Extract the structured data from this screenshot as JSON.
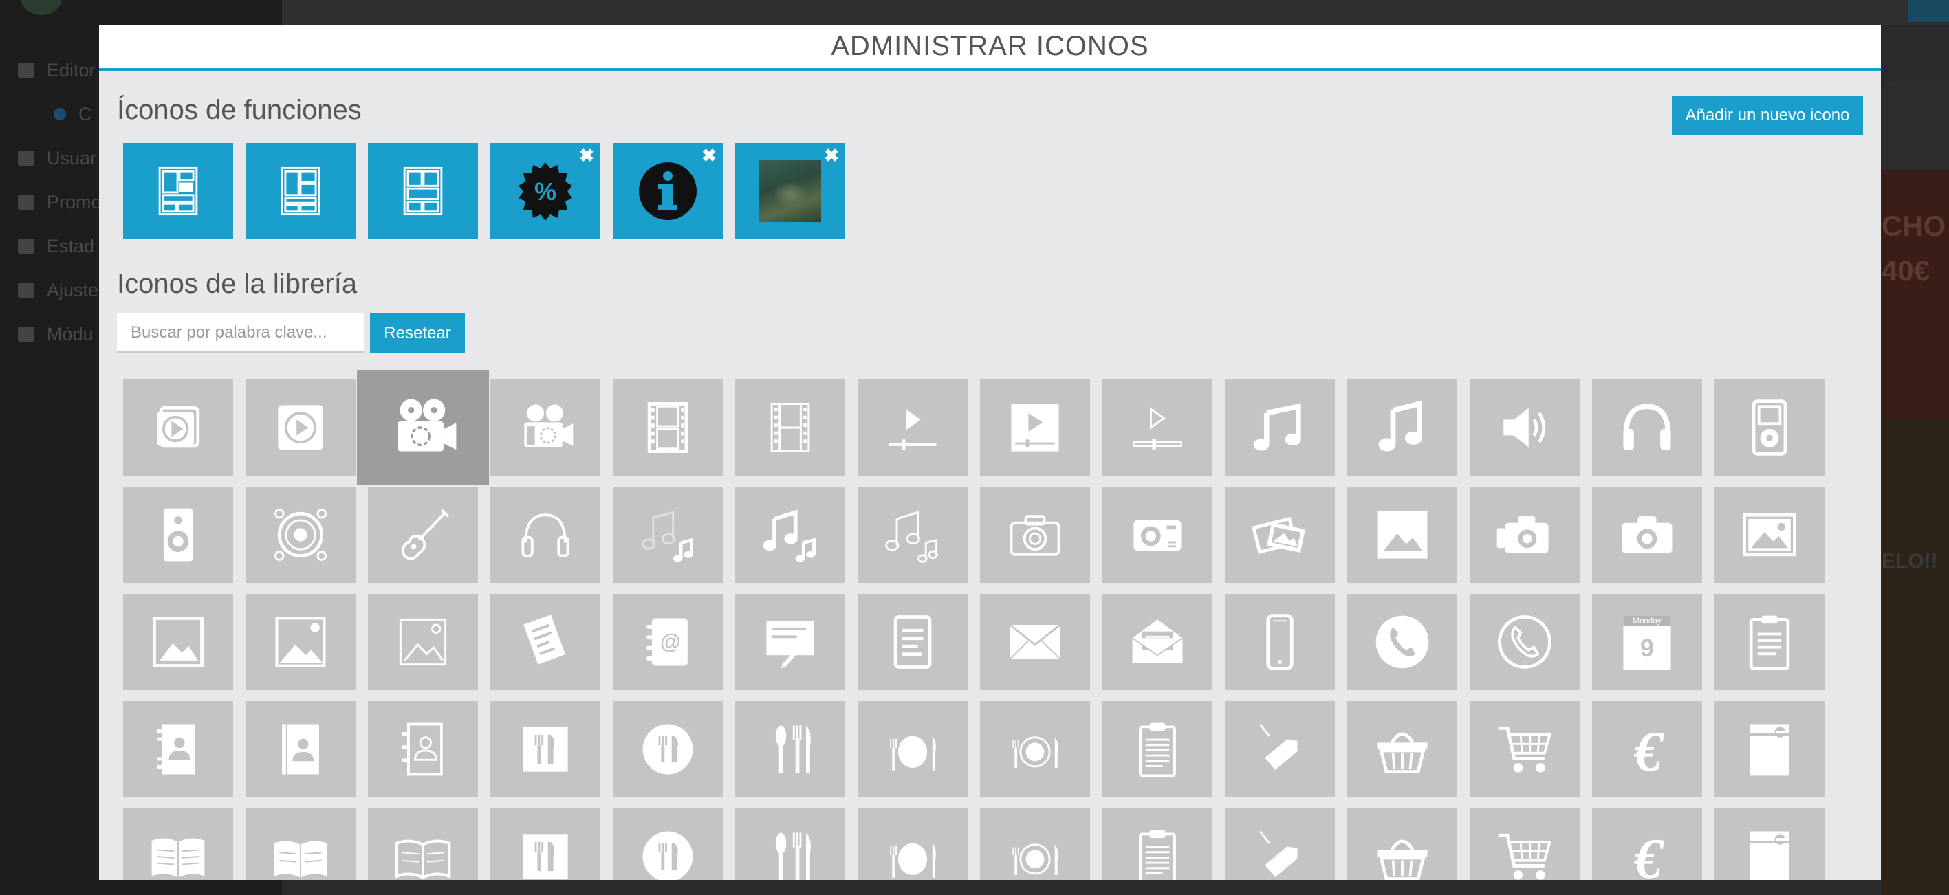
{
  "background": {
    "sidebar_items": [
      {
        "label": "Editor",
        "icon": "pencil-icon"
      },
      {
        "label": "C",
        "icon": "dot-icon",
        "sub": true
      },
      {
        "label": "Usuar",
        "icon": "users-icon"
      },
      {
        "label": "Promo",
        "icon": "megaphone-icon"
      },
      {
        "label": "Estad",
        "icon": "bar-chart-icon"
      },
      {
        "label": "Ajuste",
        "icon": "cogs-icon"
      },
      {
        "label": "Módu",
        "icon": "cubes-icon"
      }
    ],
    "phone_text": [
      "CHO",
      "40€",
      "ELO!!"
    ]
  },
  "modal": {
    "title": "ADMINISTRAR ICONOS",
    "functions_title": "Íconos de funciones",
    "add_button": "Añadir un nuevo icono",
    "library_title": "Iconos de la librería",
    "search_placeholder": "Buscar por palabra clave...",
    "reset_button": "Resetear"
  },
  "function_icons": [
    {
      "icon": "layout-1-icon",
      "removable": false
    },
    {
      "icon": "layout-2-icon",
      "removable": false
    },
    {
      "icon": "layout-3-icon",
      "removable": false
    },
    {
      "icon": "discount-badge-icon",
      "removable": true
    },
    {
      "icon": "info-icon",
      "removable": true
    },
    {
      "icon": "photo-thumbnail",
      "removable": true
    }
  ],
  "library_icons": [
    "video-play-icon",
    "play-circle-icon",
    "film-camera-icon",
    "film-camera-outline-icon",
    "film-strip-icon",
    "film-strip-outline-icon",
    "video-player-icon",
    "video-player-filled-icon",
    "video-player-outline-icon",
    "music-note-icon",
    "music-note-alt-icon",
    "speaker-volume-icon",
    "headphones-icon",
    "ipod-icon",
    "speaker-box-icon",
    "woofer-icon",
    "guitar-icon",
    "headphones-outline-icon",
    "music-notes-outline-icon",
    "music-notes-icon",
    "music-notes-alt-icon",
    "camera-outline-icon",
    "compact-camera-icon",
    "photos-icon",
    "image-icon",
    "camera-icon",
    "camera-alt-icon",
    "picture-icon",
    "image-frame-icon",
    "image-filled-icon",
    "image-outline-icon",
    "receipt-icon",
    "address-book-at-icon",
    "signed-document-icon",
    "document-list-icon",
    "envelope-icon",
    "envelope-open-icon",
    "smartphone-icon",
    "phone-circle-icon",
    "phone-circle-outline-icon",
    "calendar-icon",
    "clipboard-icon",
    "contact-book-icon",
    "contact-book-alt-icon",
    "contact-book-outline-icon",
    "restaurant-menu-icon",
    "plate-circle-icon",
    "fork-knife-icon",
    "dinner-plate-icon",
    "dinner-plate-outline-icon",
    "clipboard-list-icon",
    "price-tag-icon",
    "shopping-basket-icon",
    "shopping-cart-icon",
    "euro-icon",
    "box-icon",
    "open-book-icon",
    "open-book-alt-icon",
    "open-book-outline-icon",
    "restaurant-menu-icon",
    "plate-circle-icon",
    "fork-knife-icon",
    "dinner-plate-icon",
    "dinner-plate-outline-icon",
    "clipboard-list-icon",
    "price-tag-icon",
    "shopping-basket-icon",
    "shopping-cart-icon",
    "euro-icon",
    "box-icon"
  ],
  "calendar_icon": {
    "weekday": "Monday",
    "day": "9"
  },
  "selected_library_index": 2,
  "colors": {
    "accent": "#1a9fcd",
    "tile": "#c4c4c6",
    "tile_selected": "#9d9d9f",
    "modal_bg": "#e8e8ea"
  }
}
